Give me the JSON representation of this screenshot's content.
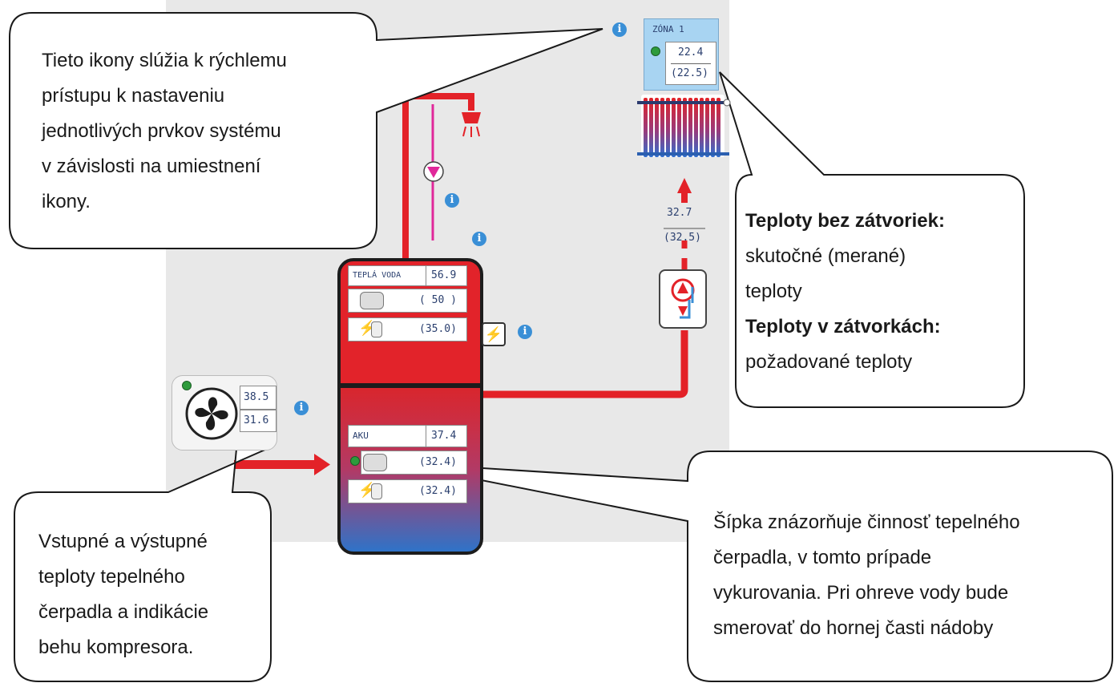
{
  "callouts": {
    "icons": [
      "Tieto ikony slúžia k rýchlemu",
      "prístupu k nastaveniu",
      "jednotlivých prvkov systému",
      "v závislosti na umiestnení",
      "ikony."
    ],
    "temps_bold_1": "Teploty bez zátvoriek:",
    "temps_line_2": "skutočné (merané)",
    "temps_line_3": "teploty",
    "temps_bold_4": "Teploty v zátvorkách:",
    "temps_line_5": "požadované teploty",
    "heatpump": [
      "Vstupné a výstupné",
      "teploty tepelného",
      "čerpadla a indikácie",
      "behu kompresora."
    ],
    "arrow": [
      "Šípka znázorňuje činnosť tepelného",
      "čerpadla, v tomto prípade",
      "vykurovania. Pri ohreve vody bude",
      "smerovať do hornej časti nádoby"
    ]
  },
  "zone": {
    "title": "ZÓNA 1",
    "actual": "22.4",
    "setpoint": "(22.5)"
  },
  "circuit": {
    "actual": "32.7",
    "setpoint": "(32.5)"
  },
  "hot_water": {
    "label": "TEPLÁ VODA",
    "actual": "56.9",
    "heater_setpoint": "( 50 )",
    "electric_setpoint": "(35.0)"
  },
  "aku": {
    "label": "AKU",
    "actual": "37.4",
    "heater_setpoint": "(32.4)",
    "electric_setpoint": "(32.4)"
  },
  "heat_pump": {
    "outlet": "38.5",
    "inlet": "31.6"
  },
  "info_icon_glyph": "i",
  "colors": {
    "pipe": "#e32228",
    "dhw_pipe": "#e0289a",
    "accent_blue": "#3a8fd6",
    "status_green": "#2e9b3c"
  }
}
